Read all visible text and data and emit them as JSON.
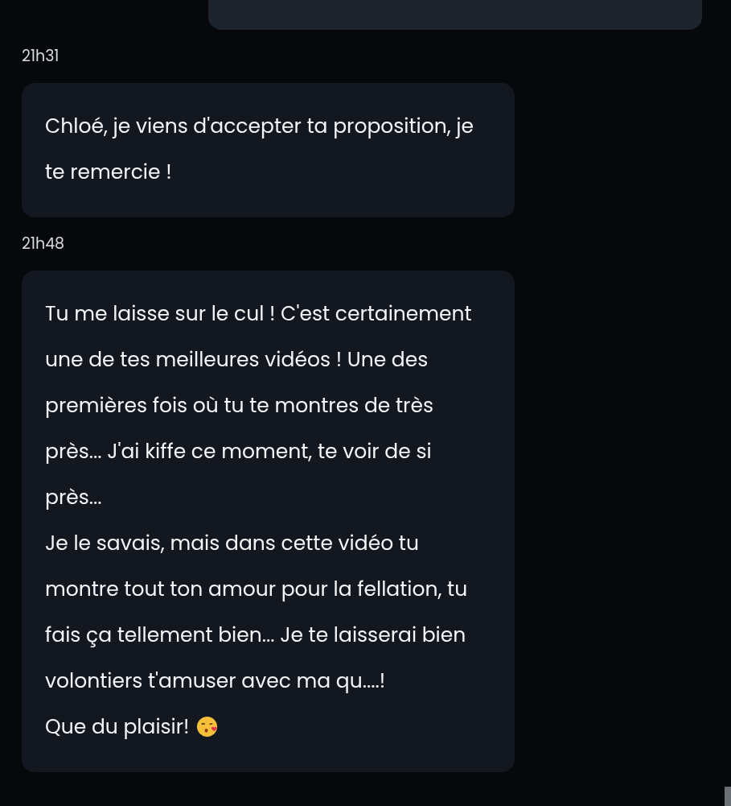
{
  "messages": [
    {
      "time": "21h31",
      "paragraphs": [
        "Chloé, je viens d'accepter ta proposition, je te remercie !"
      ],
      "emoji": false
    },
    {
      "time": "21h48",
      "paragraphs": [
        "Tu me laisse sur le cul ! C'est certainement une de tes meilleures vidéos ! Une des premières fois où tu te montres de très près... J'ai kiffe ce moment, te voir de si près...",
        "Je le savais, mais dans cette vidéo tu montre tout ton amour pour la fellation, tu fais ça tellement bien... Je te laisserai bien volontiers t'amuser avec ma qu....!",
        "Que du plaisir!"
      ],
      "emoji": true
    }
  ]
}
